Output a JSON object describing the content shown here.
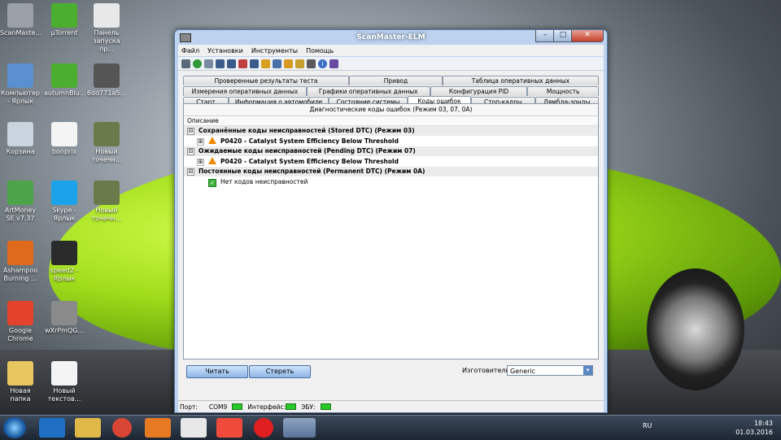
{
  "window": {
    "title": "ScanMaster-ELM",
    "controls": {
      "min": "–",
      "max": "□",
      "close": "✕"
    }
  },
  "menu": [
    "Файл",
    "Установки",
    "Инструменты",
    "Помощь"
  ],
  "tabs": {
    "row1": [
      "Проверенные результаты теста",
      "Привод",
      "Таблица оперативных данных"
    ],
    "row2": [
      "Измерения оперативных данных",
      "Графики оперативных данных",
      "Конфигурация PID",
      "Мощность"
    ],
    "row3": [
      "Старт",
      "Информация о автомобиле",
      "Состояние системы",
      "Коды ошибок",
      "Стоп-кадры",
      "Лямбда-зонды"
    ],
    "active": "Коды ошибок"
  },
  "panel": {
    "header": "Диагностические коды ошибок (Режим 03, 07, 0А)",
    "column": "Описание",
    "groups": [
      {
        "expander": "⊟",
        "title": "Сохранённые коды неисправностей (Stored DTC) (Режим 03)",
        "items": [
          {
            "expander": "⊞",
            "text": "P0420 - Catalyst System Efficiency Below Threshold"
          }
        ]
      },
      {
        "expander": "⊟",
        "title": "Ожидаемые коды неисправностей (Pending DTC) (Режим 07)",
        "items": [
          {
            "expander": "⊞",
            "text": "P0420 - Catalyst System Efficiency Below Threshold"
          }
        ]
      },
      {
        "expander": "⊟",
        "title": "Постоянные коды неисправностей (Permanent DTC) (Режим 0А)",
        "ok": "Нет кодов неисправностей"
      }
    ]
  },
  "buttons": {
    "read": "Читать",
    "clear": "Стереть"
  },
  "manufacturer": {
    "label": "Изготовитель",
    "value": "Generic",
    "arrow": "▾"
  },
  "status": {
    "port_label": "Порт:",
    "port_value": "COM9",
    "interface_label": "Интерфейс:",
    "ecu_label": "ЭБУ:"
  },
  "desktop_icons": [
    {
      "label": "ScanMaste...",
      "color": "#9aa0a6"
    },
    {
      "label": "µTorrent",
      "color": "#4cae2f"
    },
    {
      "label": "Панель запуска пр...",
      "color": "#e8e8e8"
    },
    {
      "label": "Компьютер - Ярлык",
      "color": "#5a8fd1"
    },
    {
      "label": "autumnBlu...",
      "color": "#4cae2f"
    },
    {
      "label": "6dd771a5...",
      "color": "#555"
    },
    {
      "label": "Корзина",
      "color": "#c9d4de"
    },
    {
      "label": "bonprix",
      "color": "#f4f4f4"
    },
    {
      "label": "Новый точечн...",
      "color": "#6a7a4a"
    },
    {
      "label": "ArtMoney SE v7.37",
      "color": "#4da34a"
    },
    {
      "label": "Skype - Ярлык",
      "color": "#1aa3e8"
    },
    {
      "label": "Новый точечн...",
      "color": "#6a7a4a"
    },
    {
      "label": "Ashampoo Burning ...",
      "color": "#e06a1c"
    },
    {
      "label": "speed2 - Ярлык",
      "color": "#2b2b2b"
    },
    {
      "label": "Google Chrome",
      "color": "#e2432a"
    },
    {
      "label": "wXrPmQG...",
      "color": "#8a8a8a"
    },
    {
      "label": "Новая папка",
      "color": "#e8c660"
    },
    {
      "label": "Новый текстов...",
      "color": "#f4f4f4"
    }
  ],
  "tray": {
    "lang": "RU",
    "time": "18:43",
    "date": "01.03.2016"
  }
}
